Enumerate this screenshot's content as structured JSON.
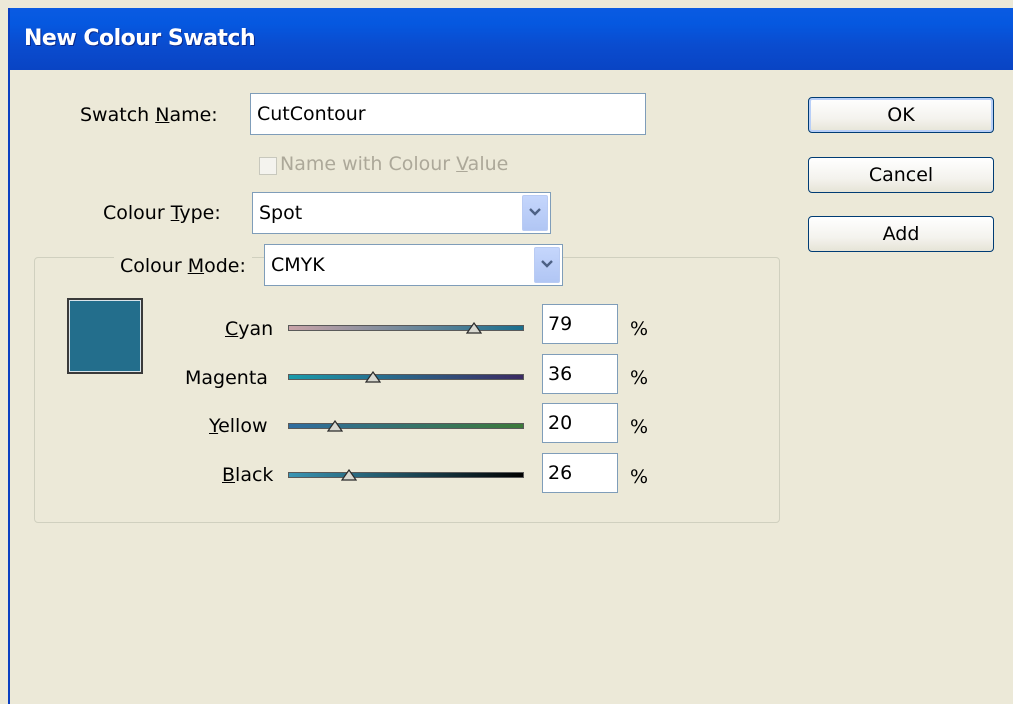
{
  "dialog": {
    "title": "New Colour Swatch"
  },
  "swatch_name": {
    "label_prefix": "Swatch ",
    "label_underlined": "N",
    "label_suffix": "ame:",
    "value": "CutContour"
  },
  "name_with_value": {
    "label_prefix": "Name with Colour ",
    "label_underlined": "V",
    "label_suffix": "alue",
    "checked": false,
    "enabled": false
  },
  "colour_type": {
    "label_prefix": "Colour ",
    "label_underlined": "T",
    "label_suffix": "ype:",
    "selected": "Spot"
  },
  "colour_mode": {
    "label_prefix": "Colour ",
    "label_underlined": "M",
    "label_suffix": "ode:",
    "selected": "CMYK"
  },
  "swatch_color": "#236e8c",
  "channels": [
    {
      "underlined": "C",
      "rest": "yan",
      "value": "79",
      "unit": "%",
      "gradient_from": "#c9a3a8",
      "gradient_to": "#1a6f8e"
    },
    {
      "underlined": "",
      "rest": "Magenta",
      "value": "36",
      "unit": "%",
      "gradient_from": "#1a9bab",
      "gradient_to": "#3b2a63"
    },
    {
      "underlined": "Y",
      "rest": "ellow",
      "value": "20",
      "unit": "%",
      "gradient_from": "#2f6da0",
      "gradient_to": "#3c7a3a"
    },
    {
      "underlined": "B",
      "rest": "lack",
      "value": "26",
      "unit": "%",
      "gradient_from": "#3a95b4",
      "gradient_to": "#000000"
    }
  ],
  "buttons": {
    "ok": "OK",
    "cancel": "Cancel",
    "add": "Add"
  }
}
